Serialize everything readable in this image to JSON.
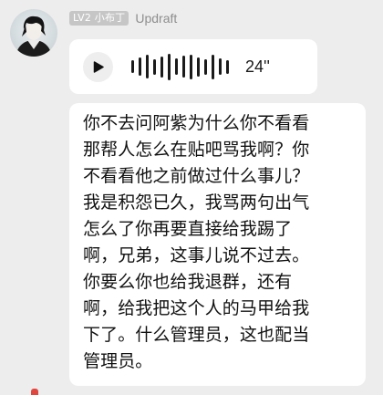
{
  "sender": {
    "level_badge": "LV2 小布丁",
    "name": "Updraft"
  },
  "voice_message": {
    "duration": "24''",
    "waveform_levels": [
      0.45,
      0.65,
      0.85,
      0.55,
      0.75,
      0.95,
      0.6,
      0.8,
      0.9,
      0.7,
      0.55,
      0.9,
      0.6,
      0.5
    ],
    "icon": "play-icon"
  },
  "text_message": {
    "content": "你不去问阿紫为什么你不看看\n那帮人怎么在贴吧骂我啊？你\n不看看他之前做过什么事儿？\n我是积怨已久，我骂两句出气\n怎么了你再要直接给我踢了\n啊，兄弟，这事儿说不过去。\n你要么你也给我退群，还有\n啊，给我把这个人的马甲给我\n下了。什么管理员，这也配当\n管理员。"
  },
  "colors": {
    "background": "#ededed",
    "bubble": "#ffffff",
    "text": "#111111",
    "badge": "#c6c6c6",
    "name": "#8e8e8e"
  }
}
